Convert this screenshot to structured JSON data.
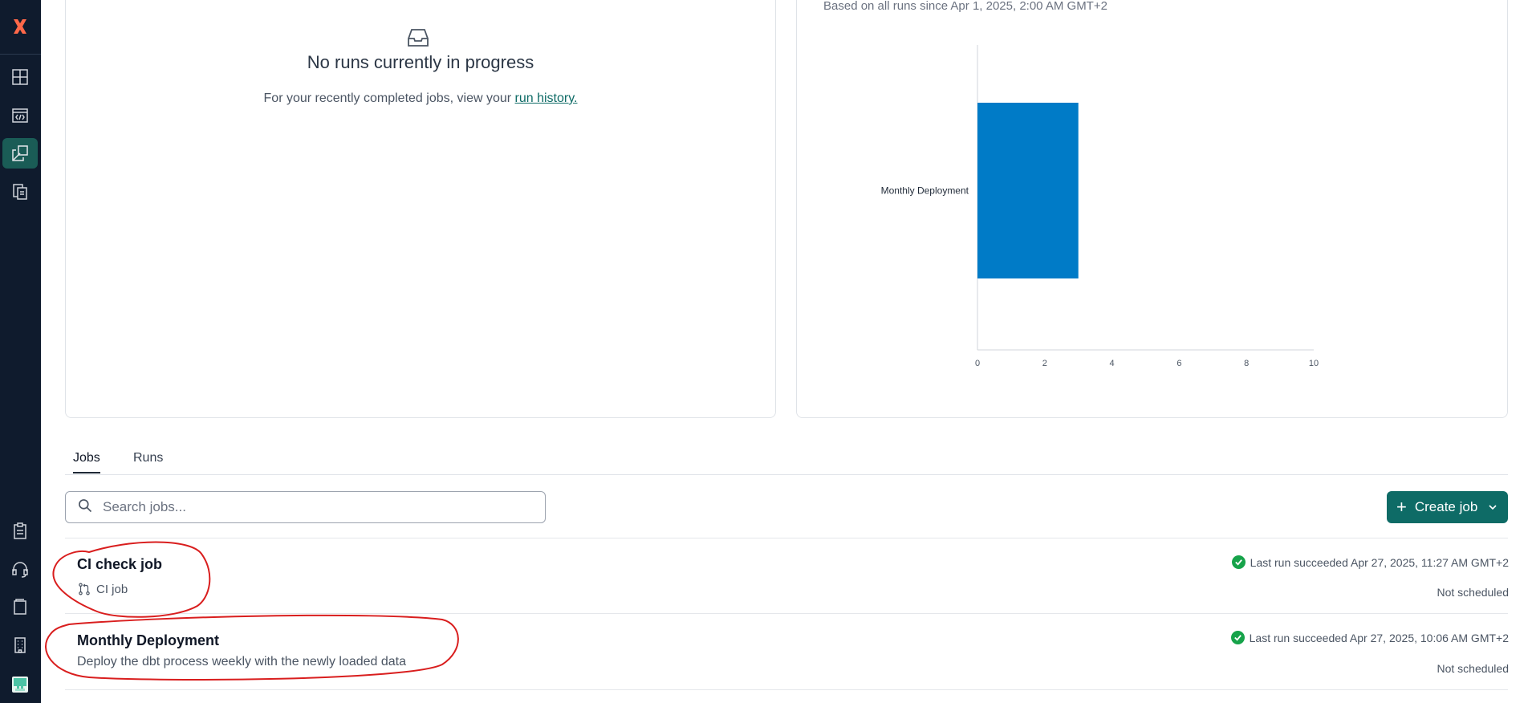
{
  "sidebar": {
    "logo_icon": "dbt-logo-icon",
    "top_items": [
      {
        "icon": "dashboard-icon"
      },
      {
        "icon": "code-editor-icon"
      },
      {
        "icon": "deploy-icon",
        "active": true
      },
      {
        "icon": "documents-icon"
      }
    ],
    "bottom_items": [
      {
        "icon": "clipboard-icon"
      },
      {
        "icon": "headset-icon"
      },
      {
        "icon": "book-icon"
      },
      {
        "icon": "building-icon"
      },
      {
        "icon": "avatar-icon"
      }
    ]
  },
  "in_progress": {
    "title": "No runs currently in progress",
    "subtitle_prefix": "For your recently completed jobs, view your ",
    "link_text": "run history."
  },
  "chart_note": "Based on all runs since Apr 1, 2025, 2:00 AM GMT+2",
  "chart_data": {
    "type": "bar",
    "orientation": "horizontal",
    "categories": [
      "Monthly Deployment"
    ],
    "values": [
      3
    ],
    "xlim": [
      0,
      10
    ],
    "xticks": [
      "0",
      "2",
      "4",
      "6",
      "8",
      "10"
    ],
    "bar_color": "#007bc7"
  },
  "tabs": [
    {
      "label": "Jobs",
      "active": true
    },
    {
      "label": "Runs",
      "active": false
    }
  ],
  "search": {
    "placeholder": "Search jobs..."
  },
  "create_button": {
    "label": "Create job"
  },
  "jobs": [
    {
      "title": "CI check job",
      "subtitle": "CI job",
      "last_run": "Last run succeeded Apr 27, 2025, 11:27 AM GMT+2",
      "schedule": "Not scheduled"
    },
    {
      "title": "Monthly Deployment",
      "description": "Deploy the dbt process weekly with the newly loaded data",
      "last_run": "Last run succeeded Apr 27, 2025, 10:06 AM GMT+2",
      "schedule": "Not scheduled"
    }
  ],
  "colors": {
    "sidebar_bg": "#0f1b2d",
    "accent": "#0e6b66",
    "success": "#16a34a",
    "annotation": "#d91e1e"
  }
}
